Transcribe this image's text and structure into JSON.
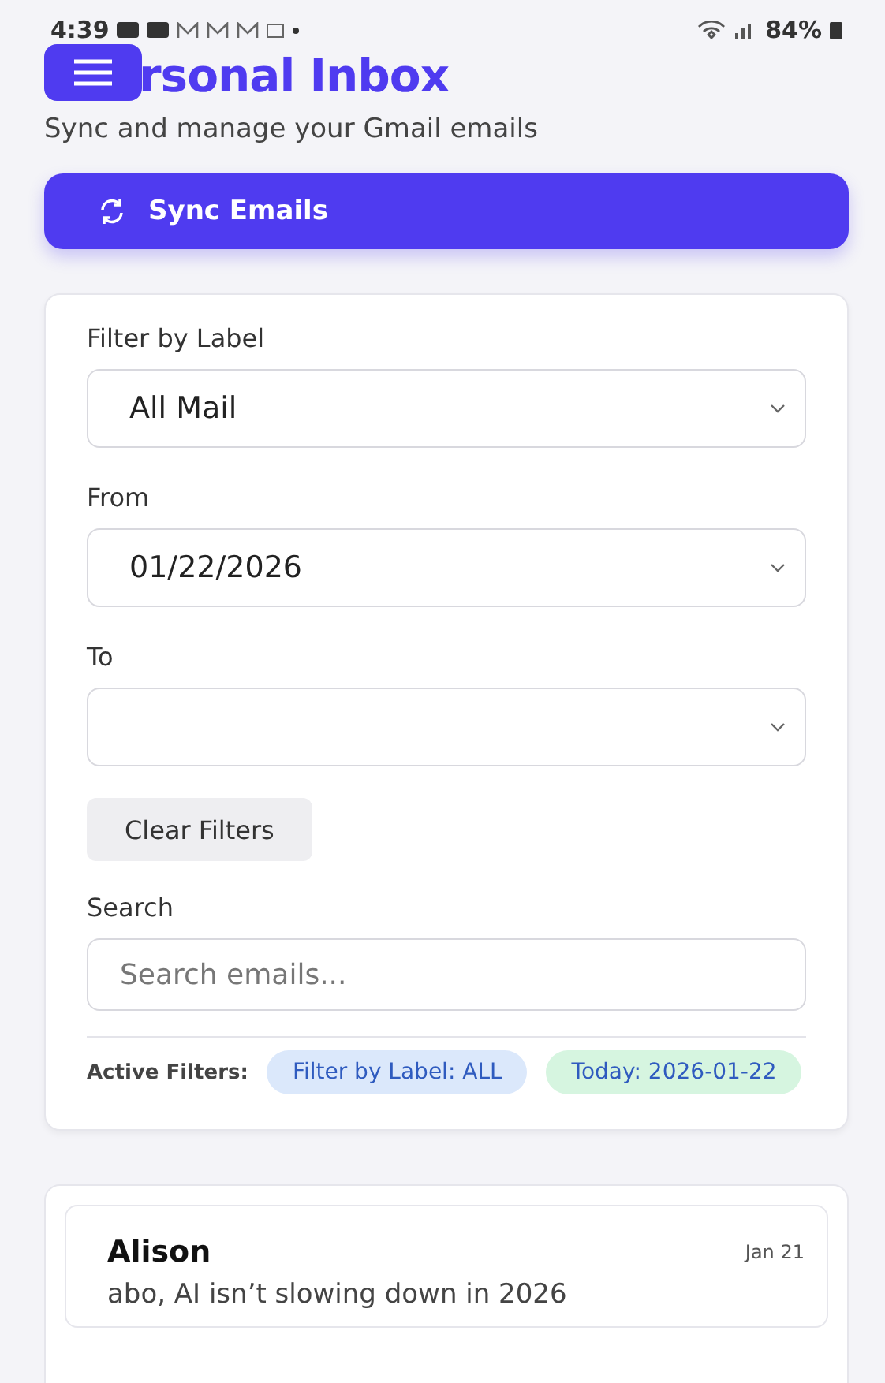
{
  "status_bar": {
    "time": "4:39",
    "battery": "84%"
  },
  "header": {
    "title": "rsonal Inbox",
    "subtitle": "Sync and manage your Gmail emails"
  },
  "sync_button": {
    "label": "Sync Emails"
  },
  "filters": {
    "fields": [
      {
        "label": "Filter by Label",
        "value": "All Mail"
      },
      {
        "label": "From",
        "value": "01/22/2026"
      },
      {
        "label": "To"
      }
    ],
    "clear_button": "Clear Filters",
    "search": {
      "label": "Search",
      "placeholder": "Search emails..."
    },
    "active_label": "Active Filters:",
    "chips": [
      {
        "text": "Filter by Label: ALL",
        "color": "#dbe8fb"
      },
      {
        "text": "Today: 2026-01-22",
        "color": "#d6f5e0"
      }
    ]
  },
  "emails": [
    {
      "sender": "Alison",
      "date": "Jan 21",
      "preview": "abo, AI isn’t slowing down in 2026"
    }
  ]
}
